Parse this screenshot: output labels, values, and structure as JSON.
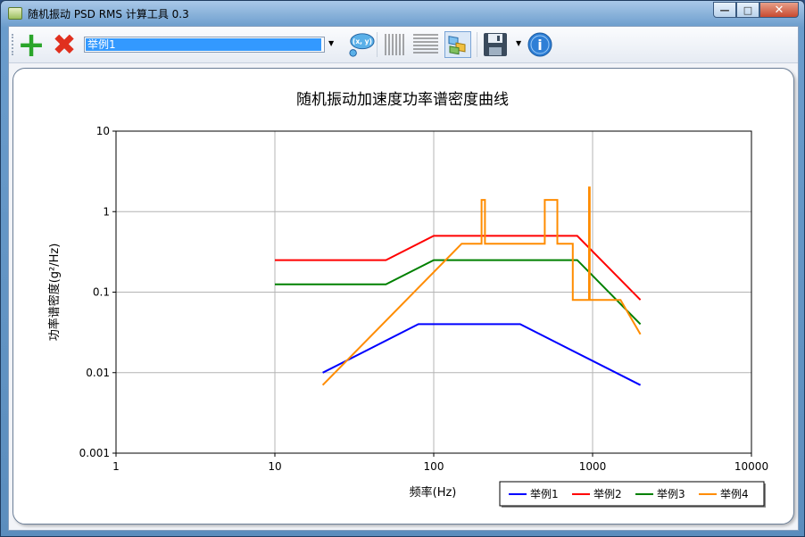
{
  "window": {
    "title": "随机振动 PSD RMS 计算工具 0.3",
    "buttons": {
      "minimize": "—",
      "maximize": "□",
      "close": "✕"
    }
  },
  "toolbar": {
    "selected_example": "举例1",
    "icons": [
      "add-icon",
      "delete-icon",
      "xy-help-icon",
      "vertical-grid-icon",
      "horizontal-grid-icon",
      "stacked-layers-icon",
      "save-icon",
      "info-icon"
    ],
    "xy_label": "(x, y)",
    "info_label": "i"
  },
  "chart_data": {
    "type": "line",
    "title": "随机振动加速度功率谱密度曲线",
    "xlabel": "频率(Hz)",
    "ylabel": "功率谱密度(g²/Hz)",
    "xscale": "log",
    "yscale": "log",
    "xlim": [
      1,
      10000
    ],
    "ylim": [
      0.001,
      10
    ],
    "x_ticks": [
      "1",
      "10",
      "100",
      "1000",
      "10000"
    ],
    "y_ticks": [
      "0.001",
      "0.01",
      "0.1",
      "1",
      "10"
    ],
    "grid": true,
    "legend": "bottom-right",
    "series": [
      {
        "name": "举例1",
        "color": "#0000ff",
        "points": [
          [
            20,
            0.01
          ],
          [
            80,
            0.04
          ],
          [
            350,
            0.04
          ],
          [
            2000,
            0.007
          ]
        ]
      },
      {
        "name": "举例2",
        "color": "#ff0000",
        "points": [
          [
            10,
            0.25
          ],
          [
            50,
            0.25
          ],
          [
            100,
            0.5
          ],
          [
            800,
            0.5
          ],
          [
            2000,
            0.08
          ]
        ]
      },
      {
        "name": "举例3",
        "color": "#008000",
        "points": [
          [
            10,
            0.125
          ],
          [
            50,
            0.125
          ],
          [
            100,
            0.25
          ],
          [
            800,
            0.25
          ],
          [
            2000,
            0.04
          ]
        ]
      },
      {
        "name": "举例4",
        "color": "#ff8c00",
        "points": [
          [
            20,
            0.007
          ],
          [
            150,
            0.4
          ],
          [
            200,
            0.4
          ],
          [
            200,
            1.4
          ],
          [
            210,
            1.4
          ],
          [
            210,
            0.4
          ],
          [
            500,
            0.4
          ],
          [
            500,
            1.4
          ],
          [
            600,
            1.4
          ],
          [
            600,
            0.4
          ],
          [
            750,
            0.4
          ],
          [
            750,
            0.08
          ],
          [
            950,
            0.08
          ],
          [
            950,
            2.0
          ],
          [
            960,
            2.0
          ],
          [
            960,
            0.08
          ],
          [
            1500,
            0.08
          ],
          [
            2000,
            0.03
          ]
        ]
      }
    ]
  }
}
